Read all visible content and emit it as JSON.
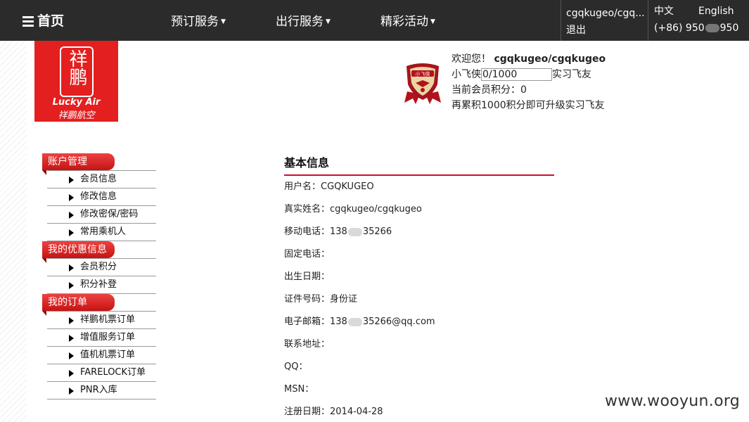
{
  "nav": {
    "home_label": "首页",
    "items": [
      {
        "label": "预订服务"
      },
      {
        "label": "出行服务"
      },
      {
        "label": "精彩活动"
      }
    ],
    "user_display": "cgqkugeo/cgq...",
    "logout_label": "退出",
    "lang_cn": "中文",
    "lang_en": "English",
    "hotline_prefix": "(+86) 950",
    "hotline_suffix": "950"
  },
  "logo": {
    "seal_text": "祥鹏",
    "brand_en": "Lucky Air",
    "brand_cn": "祥鹏航空"
  },
  "member": {
    "badge_text": "小飞侠",
    "welcome_prefix": "欢迎您！",
    "welcome_name": "cgqkugeo/cgqkugeo",
    "level_name": "小飞侠",
    "level_progress": "0/1000",
    "level_progress_fraction": 0,
    "next_level_name": "实习飞友",
    "points_line": "当前会员积分：0",
    "upgrade_line": "再累积1000积分即可升级实习飞友"
  },
  "sidebar": {
    "sections": [
      {
        "title": "账户管理",
        "items": [
          "会员信息",
          "修改信息",
          "修改密保/密码",
          "常用乘机人"
        ]
      },
      {
        "title": "我的优惠信息",
        "items": [
          "会员积分",
          "积分补登"
        ]
      },
      {
        "title": "我的订单",
        "items": [
          "祥鹏机票订单",
          "增值服务订单",
          "值机机票订单",
          "FARELOCK订单",
          "PNR入库"
        ]
      }
    ]
  },
  "profile": {
    "title": "基本信息",
    "username": "用户名：CGQKUGEO",
    "realname": "真实姓名：cgqkugeo/cgqkugeo",
    "mobile_prefix": "移动电话：138",
    "mobile_suffix": "35266",
    "landline": "固定电话：",
    "birthdate": "出生日期：",
    "id_number": "证件号码：身份证",
    "email_prefix": "电子邮箱：138",
    "email_suffix": "35266@qq.com",
    "address": "联系地址：",
    "qq": "QQ：",
    "msn": "MSN：",
    "register_date": "注册日期：2014-04-28"
  },
  "watermark": "www.wooyun.org",
  "colors": {
    "topbar": "#2b2b2b",
    "brand_red": "#e41f1f",
    "rule_red": "#c8102e"
  }
}
